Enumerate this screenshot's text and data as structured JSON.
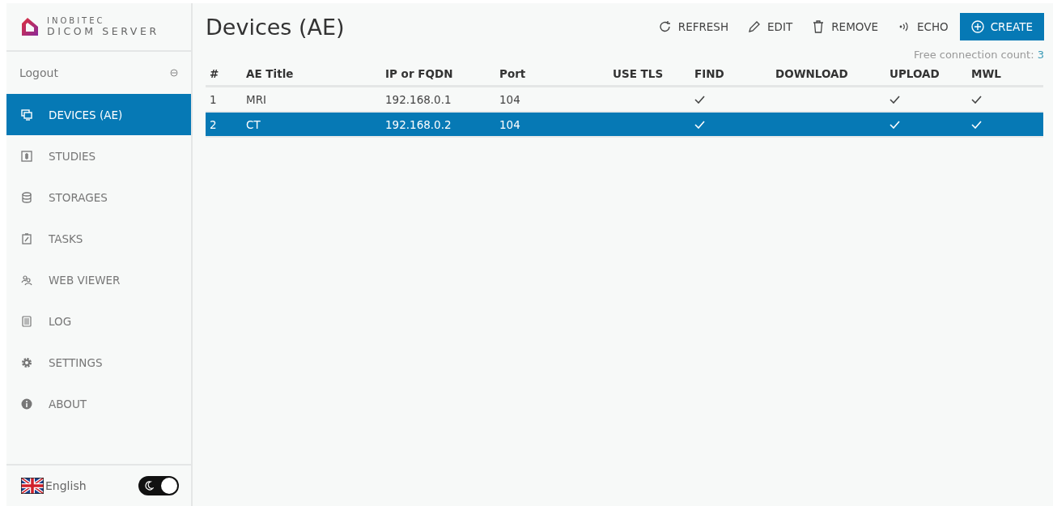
{
  "logo": {
    "line1": "INOBITEC",
    "line2": "DICOM SERVER"
  },
  "logout": {
    "label": "Logout"
  },
  "sidebar": {
    "items": [
      {
        "label": "DEVICES (AE)",
        "kind": "devices",
        "selected": true
      },
      {
        "label": "STUDIES",
        "kind": "studies",
        "selected": false
      },
      {
        "label": "STORAGES",
        "kind": "storages",
        "selected": false
      },
      {
        "label": "TASKS",
        "kind": "tasks",
        "selected": false
      },
      {
        "label": "WEB VIEWER",
        "kind": "viewer",
        "selected": false
      },
      {
        "label": "LOG",
        "kind": "log",
        "selected": false
      },
      {
        "label": "SETTINGS",
        "kind": "settings",
        "selected": false
      },
      {
        "label": "ABOUT",
        "kind": "about",
        "selected": false
      }
    ]
  },
  "language": {
    "label": "English"
  },
  "theme_toggle": {
    "on": true
  },
  "page_title": "Devices (AE)",
  "toolbar": [
    {
      "label": "REFRESH",
      "kind": "refresh"
    },
    {
      "label": "EDIT",
      "kind": "edit"
    },
    {
      "label": "REMOVE",
      "kind": "remove"
    },
    {
      "label": "ECHO",
      "kind": "echo"
    },
    {
      "label": "CREATE",
      "kind": "create"
    }
  ],
  "free_connections": {
    "label": "Free connection count:",
    "value": "3"
  },
  "table": {
    "columns": [
      "#",
      "AE Title",
      "IP or FQDN",
      "Port",
      "USE TLS",
      "FIND",
      "DOWNLOAD",
      "UPLOAD",
      "MWL"
    ],
    "rows": [
      {
        "number": "1",
        "ae_title": "MRI",
        "ip": "192.168.0.1",
        "port": "104",
        "use_tls": false,
        "find": true,
        "download": false,
        "upload": true,
        "mwl": true,
        "selected": false
      },
      {
        "number": "2",
        "ae_title": "CT",
        "ip": "192.168.0.2",
        "port": "104",
        "use_tls": false,
        "find": true,
        "download": false,
        "upload": true,
        "mwl": true,
        "selected": true
      }
    ]
  }
}
